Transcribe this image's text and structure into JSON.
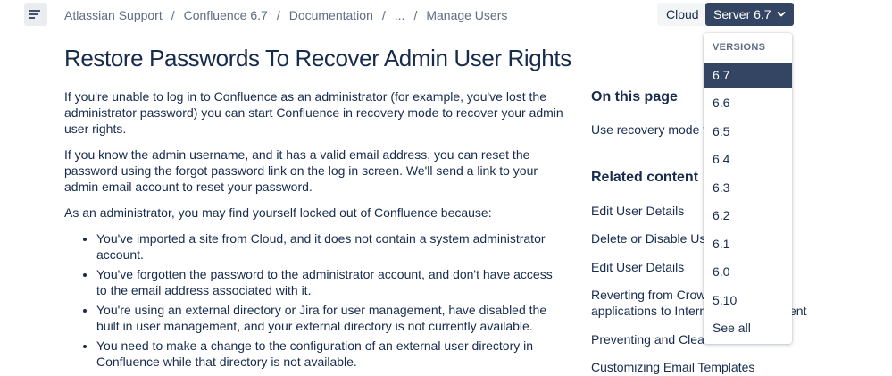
{
  "header": {
    "breadcrumb": [
      "Atlassian Support",
      "Confluence 6.7",
      "Documentation",
      "...",
      "Manage Users"
    ],
    "separator": "/",
    "cloud_label": "Cloud",
    "server_label": "Server 6.7"
  },
  "main": {
    "title": "Restore Passwords To Recover Admin User Rights",
    "paragraphs": [
      "If you're unable to log in to Confluence as an administrator (for example, you've lost the administrator password) you can start Confluence in recovery mode to recover your admin user rights.",
      "If you know the admin username, and it has a valid email address, you can reset the password using the forgot password link on the log in screen. We'll send a link to your admin email account to reset your password.",
      "As an administrator, you may find yourself locked out of Confluence because:"
    ],
    "bullets": [
      "You've imported a site from Cloud, and it does not contain a system administrator account.",
      "You've forgotten the password to the administrator account, and don't have access to the email address associated with it.",
      "You're using an external directory or Jira for user management, have disabled the built in user management, and your external directory is not currently available.",
      "You need to make a change to the configuration of an external user directory in Confluence while that directory is not available."
    ]
  },
  "sidebar": {
    "on_this_page_heading": "On this page",
    "on_this_page_links": [
      "Use recovery mode to"
    ],
    "related_heading": "Related content",
    "related_links": [
      "Edit User Details",
      "Delete or Disable User",
      "Edit User Details",
      "Reverting from Crowd",
      "applications to Internal",
      "Preventing and Cleanin",
      "Customizing Email Templates"
    ],
    "related_tail": "ent"
  },
  "versions": {
    "heading": "VERSIONS",
    "items": [
      "6.7",
      "6.6",
      "6.5",
      "6.4",
      "6.3",
      "6.2",
      "6.1",
      "6.0",
      "5.10",
      "See all"
    ],
    "selected": "6.7"
  },
  "colors": {
    "primary_dark": "#344563",
    "text": "#172b4d",
    "muted": "#5e6c84"
  },
  "icons": {
    "menu": "menu-icon",
    "chevron": "chevron-down-icon"
  }
}
